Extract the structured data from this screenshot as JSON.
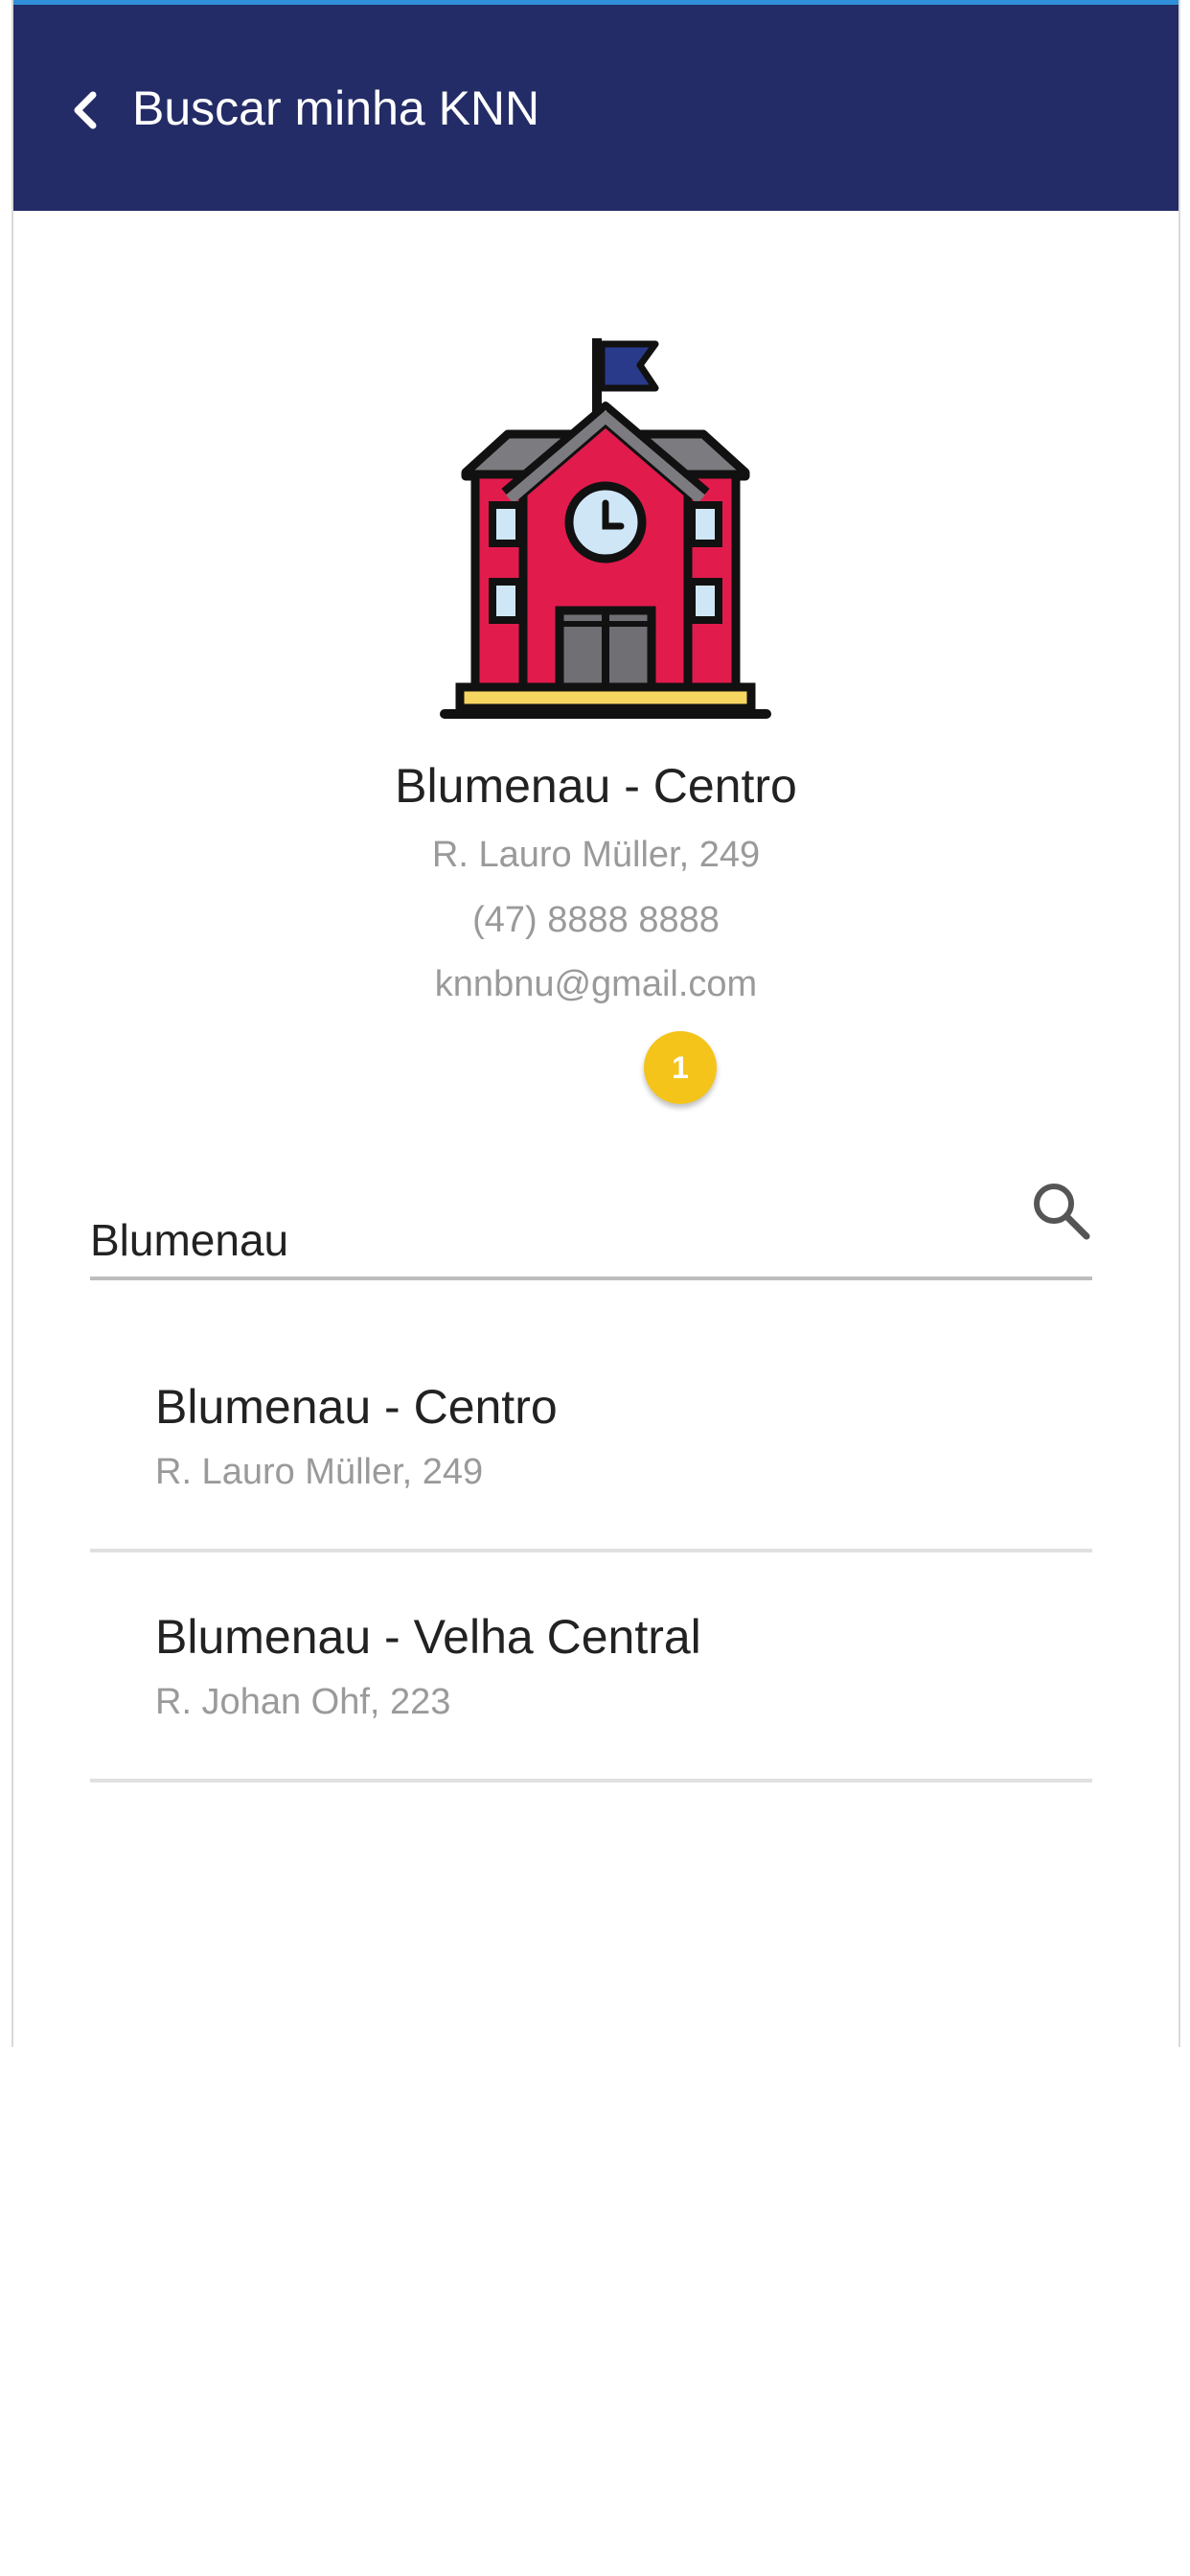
{
  "header": {
    "title": "Buscar minha KNN",
    "back_icon": "chevron-left-icon",
    "background_color": "#232c66"
  },
  "selected_unit": {
    "illustration": "school-building-icon",
    "name": "Blumenau - Centro",
    "address": "R. Lauro Müller, 249",
    "phone": "(47) 8888 8888",
    "email": "knnbnu@gmail.com"
  },
  "badge": {
    "count": "1",
    "color": "#f5c41b"
  },
  "search": {
    "value": "Blumenau",
    "icon": "search-icon"
  },
  "results": [
    {
      "name": "Blumenau - Centro",
      "address": "R. Lauro Müller, 249"
    },
    {
      "name": "Blumenau - Velha Central",
      "address": "R. Johan Ohf, 223"
    }
  ]
}
